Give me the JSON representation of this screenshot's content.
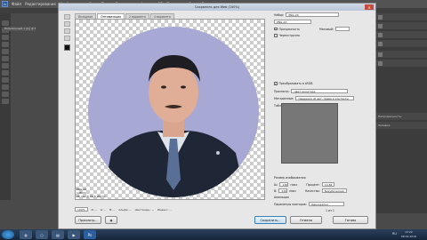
{
  "app": {
    "logo": "Ps",
    "menu": [
      "Файл",
      "Редактирование",
      "Изображение",
      "Слои",
      "Текст",
      "Выделение",
      "Фильтр",
      "3D",
      "Просмотр",
      "Окно",
      "Справка"
    ],
    "doc_tab": "Безымянный-1.jpg @ 66,7%"
  },
  "dialog": {
    "title": "Сохранить для Web (100%)",
    "close": "✕",
    "tabs": [
      "Исходное",
      "Оптимизация",
      "2 варианта",
      "4 варианта"
    ],
    "active_tab": 1,
    "preview_info": [
      "PNG-24",
      "148,7K",
      "28 сек @ 56,6 кбит/с"
    ],
    "zoom": "100%",
    "readouts": [
      "R: --",
      "G: --",
      "B: --",
      "Альфа: --",
      "Шестнадц.: --",
      "Индекс: --"
    ],
    "buttons": {
      "preview": "Просмотр...",
      "save": "Сохранить...",
      "cancel": "Отмена",
      "done": "Готово"
    }
  },
  "settings": {
    "preset_label": "Набор:",
    "preset_value": "PNG-24",
    "format_value": "PNG-24",
    "transparency": "Прозрачность",
    "matte_label": "Матовый:",
    "interlaced": "Чересстрочно",
    "convert_srgb": "Преобразовать в sRGB",
    "preview_label": "Просмотр:",
    "preview_value": "Цвет монитора",
    "metadata_label": "Метаданные:",
    "metadata_value": "Сведения об авт. праве и контакты",
    "color_table": "Таблица цветов",
    "image_size": "Размер изображения",
    "w_label": "Ш:",
    "w_value": "130",
    "h_label": "В:",
    "h_value": "130",
    "unit": "пикс",
    "percent_label": "Процент:",
    "percent_value": "14,82",
    "quality_label": "Качество:",
    "quality_value": "Бикубическая",
    "animation": "Анимация",
    "loop_label": "Параметры повторов:",
    "loop_value": "Однократно",
    "frames": "1 из 1"
  },
  "panels": {
    "labels": [
      "Непрозрачность:",
      "Заливка:"
    ]
  },
  "taskbar": {
    "time": "13:22",
    "date": "08.02.2016",
    "lang": "RU"
  }
}
